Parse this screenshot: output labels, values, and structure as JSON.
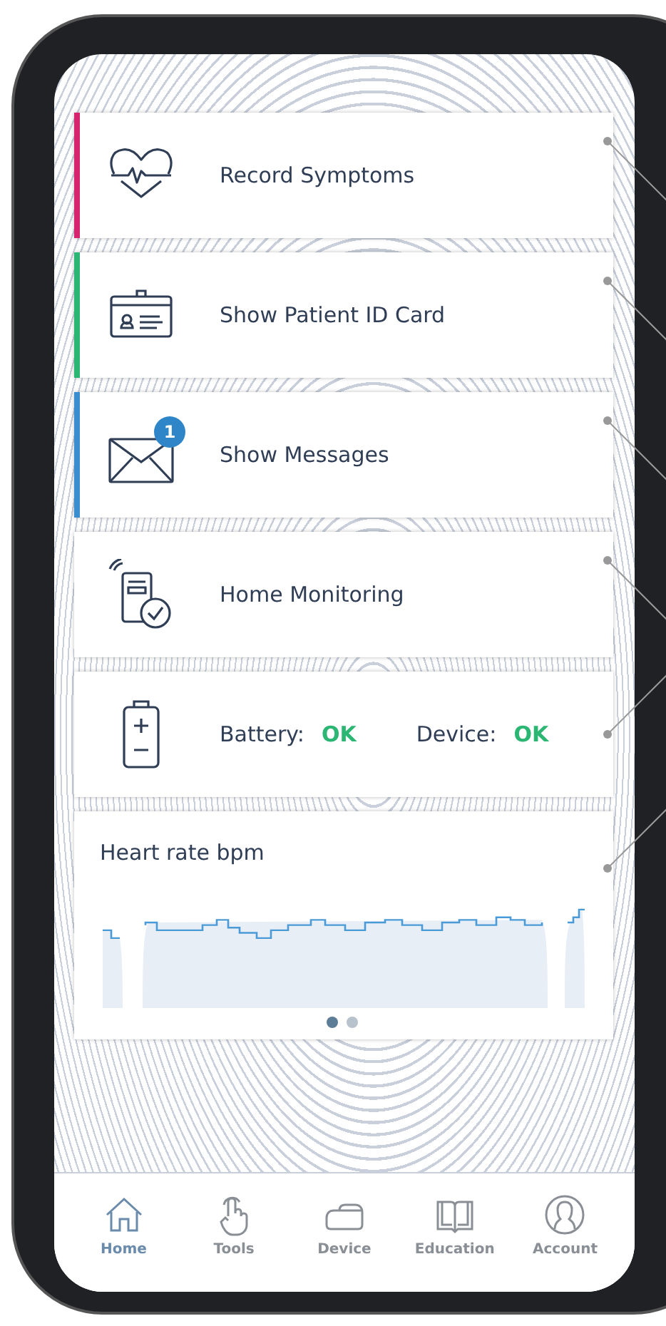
{
  "cards": [
    {
      "kind": "symptoms",
      "label": "Record Symptoms",
      "color": "#d6246e"
    },
    {
      "kind": "id-card",
      "label": "Show Patient ID Card",
      "color": "#2cb673"
    },
    {
      "kind": "messages",
      "label": "Show Messages",
      "color": "#3a8ed0",
      "badge": "1"
    },
    {
      "kind": "monitoring",
      "label": "Home Monitoring"
    },
    {
      "kind": "status",
      "items": [
        {
          "label": "Battery:",
          "value": "OK"
        },
        {
          "label": "Device:",
          "value": "OK"
        }
      ]
    },
    {
      "kind": "chart",
      "title": "Heart rate bpm",
      "pages": [
        {
          "selected": true
        },
        {
          "selected": false
        }
      ]
    }
  ],
  "nav": [
    {
      "kind": "home",
      "label": "Home",
      "selected": true
    },
    {
      "kind": "tools",
      "label": "Tools",
      "selected": false
    },
    {
      "kind": "device",
      "label": "Device",
      "selected": false
    },
    {
      "kind": "education",
      "label": "Education",
      "selected": false
    },
    {
      "kind": "account",
      "label": "Account",
      "selected": false
    }
  ]
}
